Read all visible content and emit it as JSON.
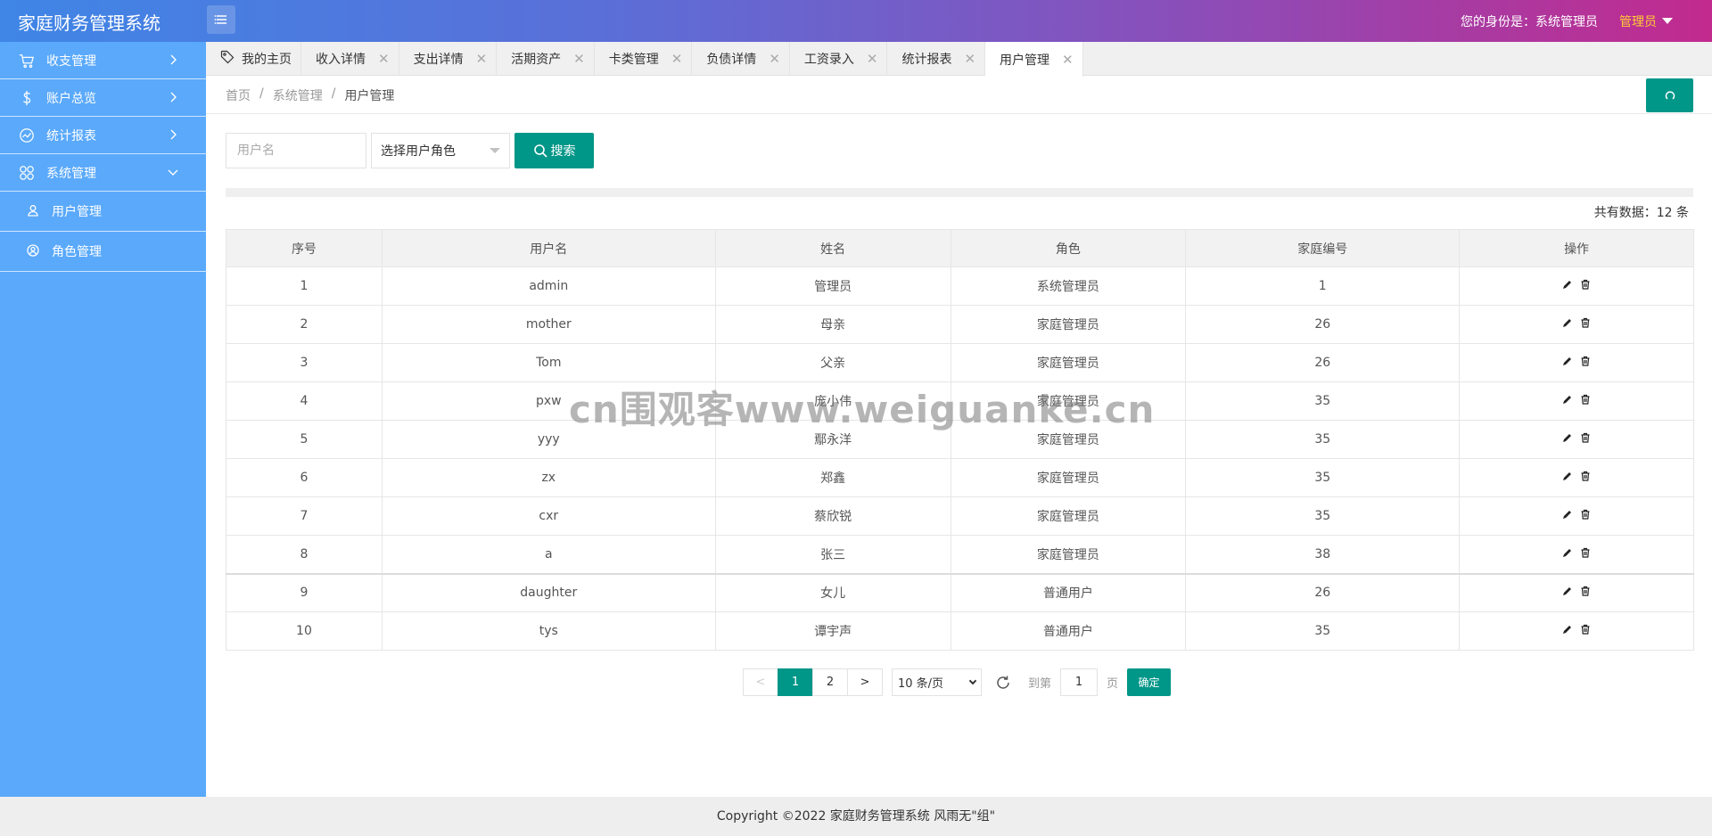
{
  "app": {
    "title": "家庭财务管理系统",
    "identity_label": "您的身份是：系统管理员",
    "user_role": "管理员"
  },
  "sidebar": {
    "items": [
      {
        "label": "收支管理",
        "icon": "cart-icon"
      },
      {
        "label": "账户总览",
        "icon": "dollar-icon"
      },
      {
        "label": "统计报表",
        "icon": "chart-line-icon"
      },
      {
        "label": "系统管理",
        "icon": "grid-icon"
      }
    ],
    "sub_items": [
      {
        "label": "用户管理",
        "icon": "user-icon"
      },
      {
        "label": "角色管理",
        "icon": "role-icon"
      }
    ]
  },
  "tabs": [
    {
      "label": "我的主页"
    },
    {
      "label": "收入详情"
    },
    {
      "label": "支出详情"
    },
    {
      "label": "活期资产"
    },
    {
      "label": "卡类管理"
    },
    {
      "label": "负债详情"
    },
    {
      "label": "工资录入"
    },
    {
      "label": "统计报表"
    },
    {
      "label": "用户管理"
    }
  ],
  "breadcrumb": [
    "首页",
    "系统管理",
    "用户管理"
  ],
  "search": {
    "username_placeholder": "用户名",
    "role_select": "选择用户角色",
    "button": "搜索"
  },
  "total_label": "共有数据：12 条",
  "table": {
    "headers": [
      "序号",
      "用户名",
      "姓名",
      "角色",
      "家庭编号",
      "操作"
    ],
    "rows": [
      [
        "1",
        "admin",
        "管理员",
        "系统管理员",
        "1"
      ],
      [
        "2",
        "mother",
        "母亲",
        "家庭管理员",
        "26"
      ],
      [
        "3",
        "Tom",
        "父亲",
        "家庭管理员",
        "26"
      ],
      [
        "4",
        "pxw",
        "庞小伟",
        "家庭管理员",
        "35"
      ],
      [
        "5",
        "yyy",
        "鄢永洋",
        "家庭管理员",
        "35"
      ],
      [
        "6",
        "zx",
        "郑鑫",
        "家庭管理员",
        "35"
      ],
      [
        "7",
        "cxr",
        "蔡欣锐",
        "家庭管理员",
        "35"
      ],
      [
        "8",
        "a",
        "张三",
        "家庭管理员",
        "38"
      ],
      [
        "9",
        "daughter",
        "女儿",
        "普通用户",
        "26"
      ],
      [
        "10",
        "tys",
        "谭宇声",
        "普通用户",
        "35"
      ]
    ]
  },
  "pagination": {
    "prev": "<",
    "pages": [
      "1",
      "2"
    ],
    "next": ">",
    "per_page": "10 条/页",
    "jump_label": "到第",
    "jump_value": "1",
    "page_label": "页",
    "confirm": "确定"
  },
  "footer": "Copyright ©2022 家庭财务管理系统 风雨无\"组\"",
  "watermark": "cn围观客www.weiguanke.cn",
  "colors": {
    "primary": "#009688",
    "sidebar": "#5aa9fb",
    "accent": "#ffcc33"
  }
}
